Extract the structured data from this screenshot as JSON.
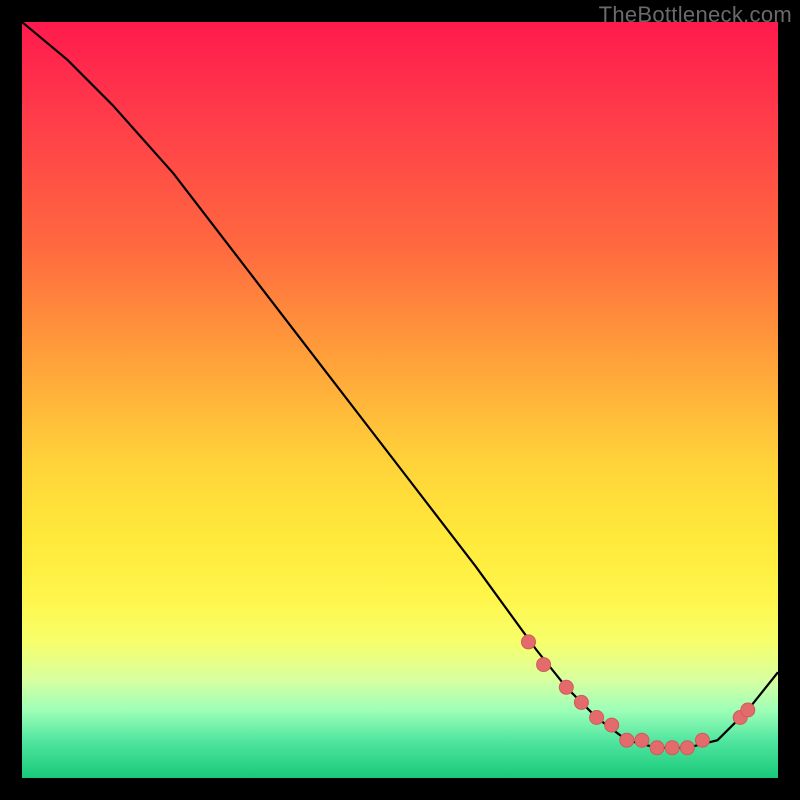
{
  "watermark": "TheBottleneck.com",
  "colors": {
    "curve": "#000000",
    "marker_fill": "#e46b6b",
    "marker_stroke": "#d25a5a"
  },
  "chart_data": {
    "type": "line",
    "title": "",
    "xlabel": "",
    "ylabel": "",
    "xlim": [
      0,
      100
    ],
    "ylim": [
      0,
      100
    ],
    "series": [
      {
        "name": "curve",
        "x": [
          0,
          6,
          12,
          20,
          30,
          40,
          50,
          60,
          68,
          72,
          76,
          80,
          84,
          88,
          92,
          96,
          100
        ],
        "y": [
          100,
          95,
          89,
          80,
          67,
          54,
          41,
          28,
          17,
          12,
          8,
          5,
          4,
          4,
          5,
          9,
          14
        ]
      }
    ],
    "markers": {
      "name": "highlighted-points",
      "x": [
        67,
        69,
        72,
        74,
        76,
        78,
        80,
        82,
        84,
        86,
        88,
        90,
        95,
        96
      ],
      "y": [
        18,
        15,
        12,
        10,
        8,
        7,
        5,
        5,
        4,
        4,
        4,
        5,
        8,
        9
      ]
    }
  }
}
